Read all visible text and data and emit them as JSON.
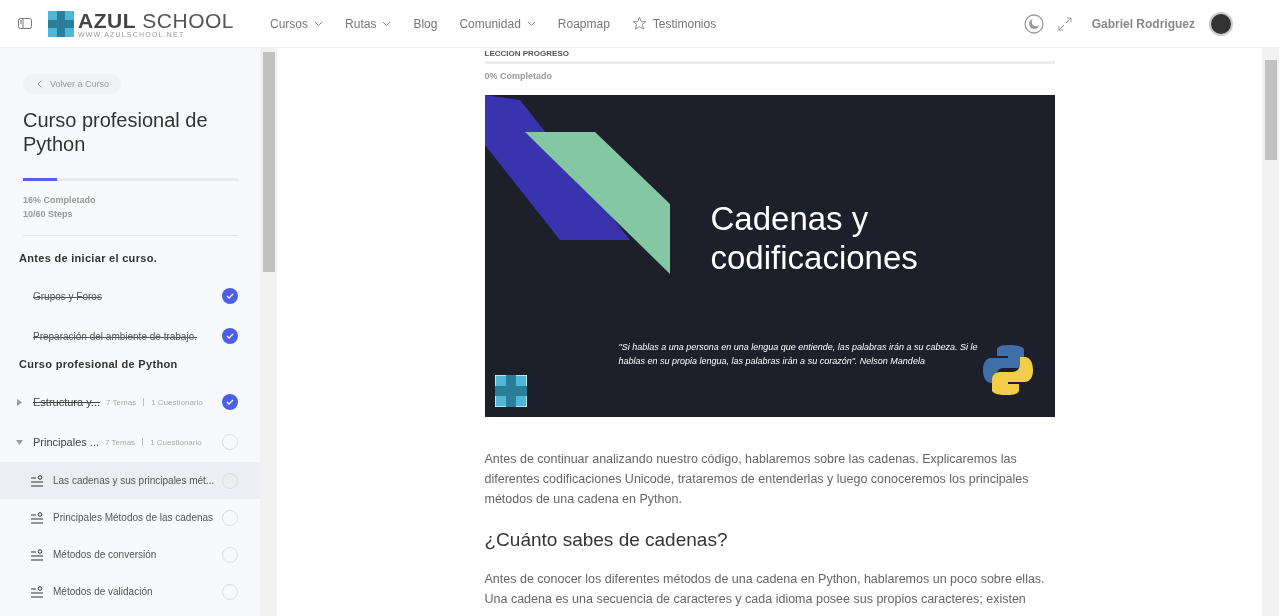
{
  "header": {
    "logo": {
      "name": "AZUL",
      "suffix": "SCHOOL",
      "tagline": "WWW.AZULSCHOOL.NET"
    },
    "nav": [
      {
        "label": "Cursos",
        "dropdown": true
      },
      {
        "label": "Rutas",
        "dropdown": true
      },
      {
        "label": "Blog",
        "dropdown": false
      },
      {
        "label": "Comunidad",
        "dropdown": true
      },
      {
        "label": "Roapmap",
        "dropdown": false
      },
      {
        "label": "Testimonios",
        "dropdown": false
      }
    ],
    "user": "Gabriel Rodriguez"
  },
  "sidebar": {
    "back": "Volver a Curso",
    "course_title": "Curso profesional de Python",
    "progress": {
      "level": 0.16,
      "percent": "16% Completado",
      "steps": "10/60 Steps"
    },
    "sections": [
      {
        "title": "Antes de iniciar el curso.",
        "items": [
          {
            "kind": "lesson",
            "label": "Grupos y Foros",
            "done": true
          },
          {
            "kind": "lesson",
            "label": "Preparación del ambiente de trabajo.",
            "done": true
          }
        ]
      },
      {
        "title": "Curso profesional de Python",
        "items": [
          {
            "kind": "topic",
            "label": "Estructura y...",
            "temas": "7 Temas",
            "quiz": "1 Cuestionario",
            "expanded": false,
            "done": true
          },
          {
            "kind": "topic",
            "label": "Principales ...",
            "temas": "7 Temas",
            "quiz": "1 Cuestionario",
            "expanded": true,
            "done": false,
            "children": [
              {
                "label": "Las cadenas y sus principales mét...",
                "done": false,
                "selected": true
              },
              {
                "label": "Principales Métodos de las cadenas",
                "done": false,
                "selected": false
              },
              {
                "label": "Métodos de conversión",
                "done": false,
                "selected": false
              },
              {
                "label": "Métodos de validación",
                "done": false,
                "selected": false
              }
            ]
          }
        ]
      }
    ]
  },
  "lesson": {
    "progress_label": "LECCION PROGRESO",
    "progress": {
      "level": 0,
      "percent": "0% Completado"
    },
    "slide": {
      "title": "Cadenas y codificaciones",
      "quote": "\"Si hablas a una persona en una lengua que entiende, las palabras irán a su cabeza. Si le hablas en su propia lengua, las palabras irán a su corazón\".  Nelson Mandela"
    },
    "intro": "Antes de continuar analizando nuestro código, hablaremos sobre las cadenas. Explicaremos las diferentes codificaciones Unicode, trataremos de entenderlas y luego conoceremos los principales métodos de una cadena en Python.",
    "heading": "¿Cuánto sabes de cadenas?",
    "body": "Antes de conocer los diferentes métodos de una cadena en Python, hablaremos un poco sobre ellas. Una cadena es una secuencia de caracteres y cada idioma posee sus propios caracteres; existen"
  }
}
